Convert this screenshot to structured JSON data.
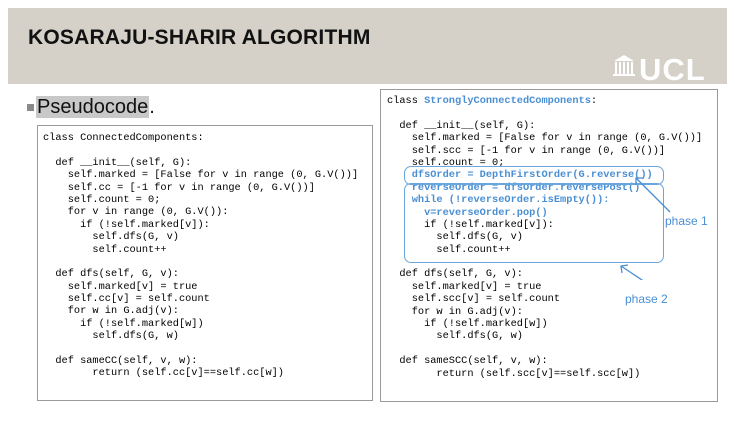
{
  "slide": {
    "title": "KOSARAJU-SHARIR ALGORITHM",
    "logo_text": "UCL",
    "bullet_text": "Pseudocode",
    "bullet_suffix": ".",
    "phase1_label": "phase 1",
    "phase2_label": "phase 2",
    "colors": {
      "header_bg": "#d5d1c9",
      "accent_blue": "#4a8fd4"
    }
  },
  "left_code": [
    "class ConnectedComponents:",
    "",
    "  def __init__(self, G):",
    "    self.marked = [False for v in range (0, G.V())]",
    "    self.cc = [-1 for v in range (0, G.V())]",
    "    self.count = 0;",
    "    for v in range (0, G.V()):",
    "      if (!self.marked[v]):",
    "        self.dfs(G, v)",
    "        self.count++",
    "",
    "  def dfs(self, G, v):",
    "    self.marked[v] = true",
    "    self.cc[v] = self.count",
    "    for w in G.adj(v):",
    "      if (!self.marked[w])",
    "        self.dfs(G, w)",
    "",
    "  def sameCC(self, v, w):",
    "        return (self.cc[v]==self.cc[w])"
  ],
  "right_code": {
    "class_prefix": "class ",
    "class_name": "StronglyConnectedComponents",
    "class_suffix": ":",
    "lines": [
      "",
      "  def __init__(self, G):",
      "    self.marked = [False for v in range (0, G.V())]",
      "    self.scc = [-1 for v in range (0, G.V())]",
      "    self.count = 0;",
      "    dfsOrder = DepthFirstOrder(G.reverse())",
      "    reverseOrder = dfsOrder.reversePost()",
      "    while (!reverseOrder.isEmpty()):",
      "      v=reverseOrder.pop()",
      "      if (!self.marked[v]):",
      "        self.dfs(G, v)",
      "        self.count++",
      "",
      "  def dfs(self, G, v):",
      "    self.marked[v] = true",
      "    self.scc[v] = self.count",
      "    for w in G.adj(v):",
      "      if (!self.marked[w])",
      "        self.dfs(G, w)",
      "",
      "  def sameSCC(self, v, w):",
      "        return (self.scc[v]==self.scc[w])"
    ],
    "highlighted_line_indices": [
      5,
      6,
      7,
      8
    ]
  }
}
